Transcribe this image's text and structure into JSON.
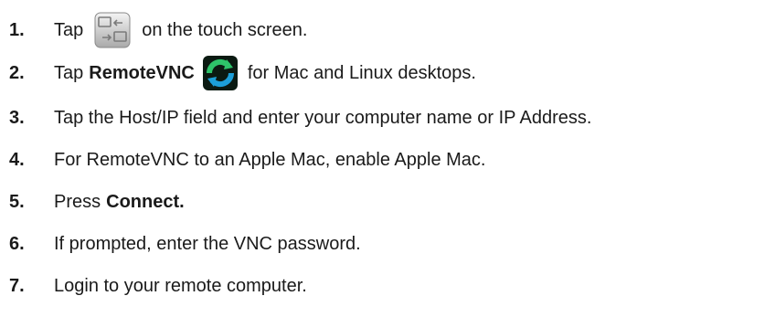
{
  "steps": [
    {
      "number": "1.",
      "pre": "Tap",
      "post": "on the touch screen."
    },
    {
      "number": "2.",
      "pre": "Tap",
      "bold": "RemoteVNC",
      "post": "for Mac and Linux desktops."
    },
    {
      "number": "3.",
      "text": "Tap the Host/IP field and enter your computer name or IP Address."
    },
    {
      "number": "4.",
      "text": "For RemoteVNC to an Apple Mac, enable Apple Mac."
    },
    {
      "number": "5.",
      "pre": "Press",
      "bold": "Connect."
    },
    {
      "number": "6.",
      "text": "If prompted, enter the VNC password."
    },
    {
      "number": "7.",
      "text": "Login to your remote computer."
    }
  ],
  "icons": {
    "step1": "remote-desktop-icon",
    "step2": "remotevnc-icon"
  }
}
